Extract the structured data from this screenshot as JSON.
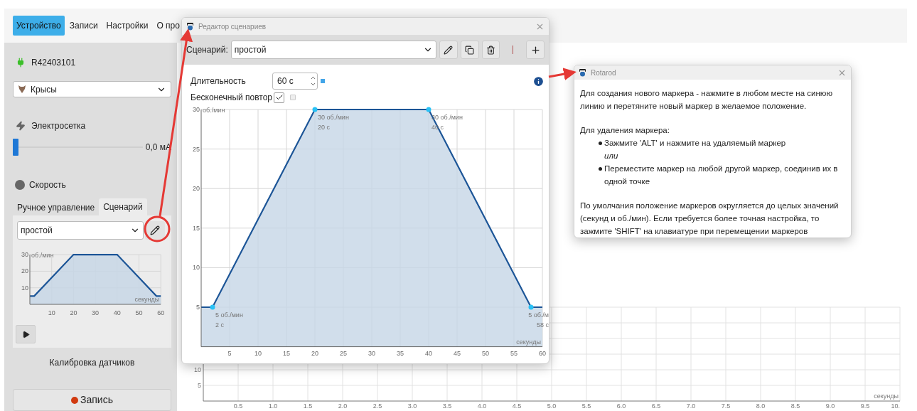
{
  "menu": {
    "tabs": [
      {
        "label": "Устройство",
        "selected": true
      },
      {
        "label": "Записи",
        "selected": false
      },
      {
        "label": "Настройки",
        "selected": false
      },
      {
        "label": "О про",
        "selected": false
      }
    ]
  },
  "device": {
    "serial": "R42403101",
    "connected": true,
    "animal": "Крысы"
  },
  "grid": {
    "label": "Электросетка",
    "level": 0,
    "reading": "0,0 мА"
  },
  "speed": {
    "label": "Скорость"
  },
  "mode_tabs": [
    {
      "label": "Ручное управление",
      "selected": false
    },
    {
      "label": "Сценарий",
      "selected": true
    }
  ],
  "scenario": {
    "value": "простой",
    "chart_data": {
      "type": "area",
      "grid": true,
      "ylabel": "об./мин",
      "xlabel": "секунды",
      "x": [
        0,
        2,
        20,
        40,
        58,
        60
      ],
      "series": [
        {
          "color": "#1c5597",
          "values": [
            5,
            5,
            30,
            30,
            5,
            5
          ]
        }
      ],
      "xlim": [
        0,
        60
      ],
      "ylim": [
        0,
        30
      ],
      "xticks": [
        10,
        20,
        30,
        40,
        50,
        60
      ],
      "yticks": [
        10,
        20,
        30
      ]
    }
  },
  "calibration": "Калибровка датчиков",
  "record_button": "Запись",
  "background_chart": {
    "chart_data": {
      "type": "line",
      "grid": true,
      "xlabel": "секунды",
      "xlim": [
        0,
        10
      ],
      "ylim": [
        0,
        30
      ],
      "xticks": [
        {
          "value": 0.5,
          "label": "0.5"
        },
        {
          "value": 1,
          "label": "1.0"
        },
        {
          "value": 1.5,
          "label": "1.5"
        },
        {
          "value": 2,
          "label": "2.0"
        },
        {
          "value": 2.5,
          "label": "2.5"
        },
        {
          "value": 3,
          "label": "3.0"
        },
        {
          "value": 3.5,
          "label": "3.5"
        },
        {
          "value": 4,
          "label": "4.0"
        },
        {
          "value": 4.5,
          "label": "4.5"
        },
        {
          "value": 5,
          "label": "5.0"
        },
        {
          "value": 5.5,
          "label": "5.5"
        },
        {
          "value": 6,
          "label": "6.0"
        },
        {
          "value": 6.5,
          "label": "6.5"
        },
        {
          "value": 7,
          "label": "7.0"
        },
        {
          "value": 7.5,
          "label": "7.5"
        },
        {
          "value": 8,
          "label": "8.0"
        },
        {
          "value": 8.5,
          "label": "8.5"
        },
        {
          "value": 9,
          "label": "9.0"
        },
        {
          "value": 9.5,
          "label": "9.5"
        },
        {
          "value": 10,
          "label": "10."
        }
      ],
      "yticks": [
        5,
        10
      ]
    }
  },
  "editor": {
    "title": "Редактор сценариев",
    "scenario_label": "Сценарий:",
    "scenario_value": "простой",
    "duration_label": "Длительность",
    "duration_value": "60 с",
    "repeat_label": "Бесконечный повтор",
    "repeat_checked": true,
    "chart_data": {
      "type": "area",
      "grid": true,
      "ylabel": "об./мин",
      "xlabel": "секунды",
      "x": [
        0,
        2,
        20,
        40,
        58,
        60
      ],
      "series": [
        {
          "color": "#1c5597",
          "values": [
            5,
            5,
            30,
            30,
            5,
            5
          ]
        }
      ],
      "xlim": [
        0,
        60
      ],
      "ylim": [
        0,
        30
      ],
      "xticks": [
        5,
        10,
        15,
        20,
        25,
        30,
        35,
        40,
        45,
        50,
        55,
        60
      ],
      "yticks": [
        5,
        10,
        15,
        20,
        25,
        30
      ]
    },
    "markers": [
      {
        "speed": "5 об./мин",
        "time": "2 с"
      },
      {
        "speed": "30 об./мин",
        "time": "20 с"
      },
      {
        "speed": "30 об./мин",
        "time": "40 с"
      },
      {
        "speed": "5 об./м",
        "time": "58 с"
      }
    ]
  },
  "help": {
    "title": "Rotarod",
    "blocks": [
      {
        "kind": "paragraph",
        "text": "Для создания нового маркера - нажмите в любом месте на синюю линию и перетяните новый маркер в желаемое положение."
      },
      {
        "kind": "paragraph",
        "text": "Для удаления маркера:"
      },
      {
        "kind": "bullet",
        "text": "Зажмите 'ALT' и нажмите на удаляемый маркер"
      },
      {
        "kind": "note",
        "text": "или"
      },
      {
        "kind": "bullet",
        "text": "Переместите маркер на любой другой маркер, соединив их в одной точке"
      },
      {
        "kind": "paragraph",
        "text": "По умолчания положение маркеров округляется до целых значений (секунд и об./мин). Если требуется более точная настройка, то зажмите 'SHIFT' на клавиатуре при перемещении маркеров"
      }
    ]
  }
}
